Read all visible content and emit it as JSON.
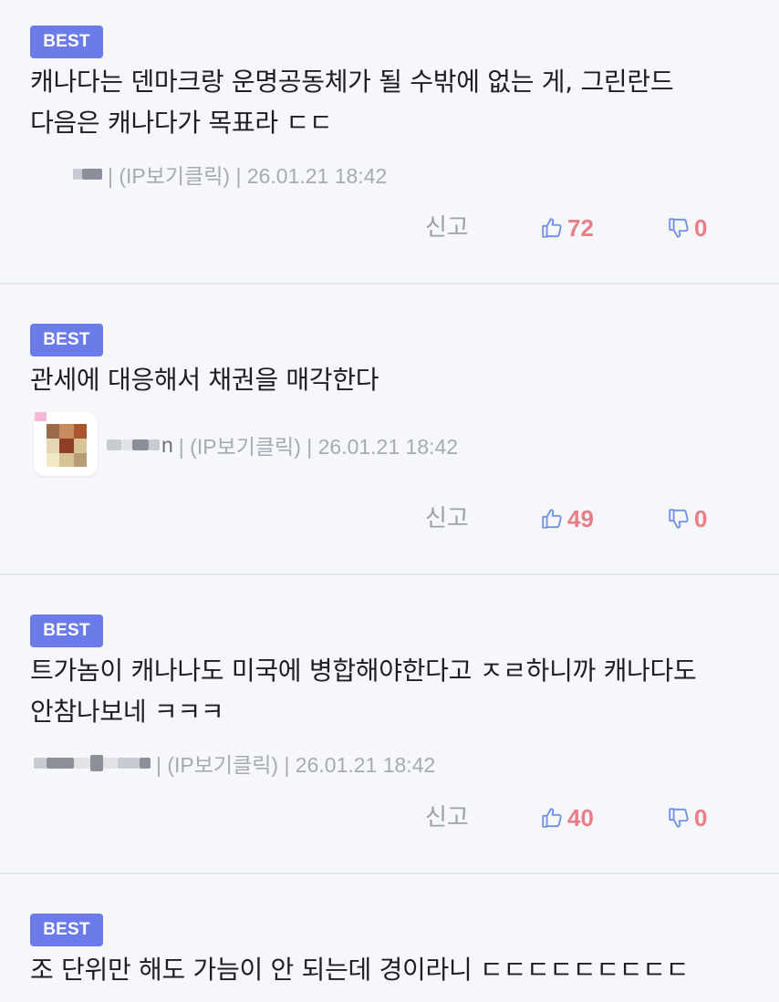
{
  "comments": [
    {
      "badge": "BEST",
      "text": "캐나다는 덴마크랑 운명공동체가 될 수밖에 없는 게, 그린란드\n다음은 캐나다가 목표라 ㄷㄷ",
      "nick_suffix": "",
      "meta": "| (IP보기클릭) | 26.01.21 18:42",
      "report": "신고",
      "likes": "72",
      "dislikes": "0"
    },
    {
      "badge": "BEST",
      "text": "관세에 대응해서 채권을 매각한다",
      "nick_suffix": "n",
      "meta": "| (IP보기클릭) | 26.01.21 18:42",
      "report": "신고",
      "likes": "49",
      "dislikes": "0"
    },
    {
      "badge": "BEST",
      "text": "트가놈이 캐나나도 미국에 병합해야한다고 ㅈㄹ하니까 캐나다도\n안참나보네 ㅋㅋㅋ",
      "nick_suffix": "",
      "meta": "| (IP보기클릭) | 26.01.21 18:42",
      "report": "신고",
      "likes": "40",
      "dislikes": "0"
    },
    {
      "badge": "BEST",
      "text": "조 단위만 해도 가늠이 안 되는데 경이라니 ㄷㄷㄷㄷㄷㄷㄷㄷㄷ"
    }
  ],
  "colors": {
    "badge_bg": "#6b7bea",
    "vote_count": "#ea7e86",
    "vote_icon": "#6f8fe8",
    "meta_text": "#a7aab3"
  },
  "icons": {
    "like": "thumbs-up-icon",
    "dislike": "thumbs-down-icon",
    "avatar": "pixel-avatar-icon"
  }
}
